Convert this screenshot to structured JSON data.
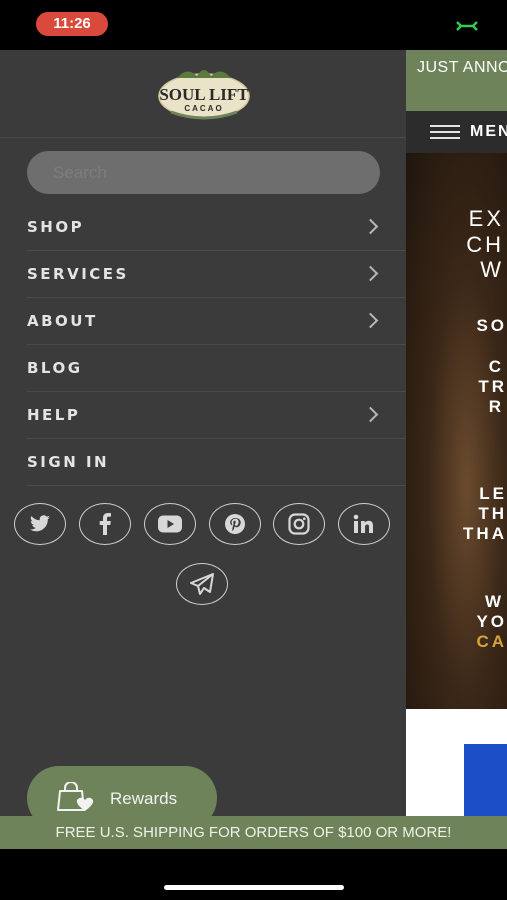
{
  "status_bar": {
    "time": "11:26",
    "battery_icon": "charging-battery-icon"
  },
  "drawer": {
    "logo": {
      "brand": "SOUL LIFT",
      "sub": "CACAO"
    },
    "search": {
      "placeholder": "Search",
      "value": ""
    },
    "menu": [
      {
        "label": "SHOP",
        "has_submenu": true
      },
      {
        "label": "SERVICES",
        "has_submenu": true
      },
      {
        "label": "ABOUT",
        "has_submenu": true
      },
      {
        "label": "BLOG",
        "has_submenu": false
      },
      {
        "label": "HELP",
        "has_submenu": true
      },
      {
        "label": "SIGN IN",
        "has_submenu": false
      }
    ],
    "social_icons": [
      "twitter-icon",
      "facebook-icon",
      "youtube-icon",
      "pinterest-icon",
      "instagram-icon",
      "linkedin-icon",
      "telegram-icon"
    ],
    "rewards": {
      "label": "Rewards",
      "icon": "shopping-bag-heart-icon"
    }
  },
  "page": {
    "announcement": "JUST ANNO",
    "menu_label": "MEN",
    "hero_lines": [
      "EX",
      "CH",
      "W",
      "SO",
      "C",
      "TR",
      "R",
      "LE",
      "TH",
      "THA",
      "W",
      "YO",
      "CA"
    ],
    "hero_accent_color": "#d4a53a"
  },
  "shipping_banner": "FREE U.S. SHIPPING FOR ORDERS OF $100 OR MORE!",
  "colors": {
    "drawer_bg": "#3b3b3b",
    "brand_green": "#6e835a",
    "text_light": "#e4e4e4"
  }
}
